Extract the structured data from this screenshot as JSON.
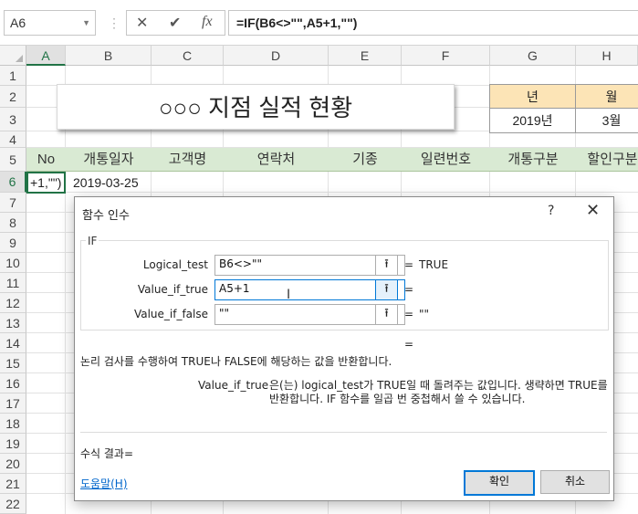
{
  "formula_bar": {
    "name_box": "A6",
    "cancel_glyph": "✕",
    "enter_glyph": "✔",
    "fx_glyph": "fx",
    "formula": "=IF(B6<>\"\",A5+1,\"\")"
  },
  "sheet": {
    "columns": [
      "A",
      "B",
      "C",
      "D",
      "E",
      "F",
      "G",
      "H"
    ],
    "rows": [
      "1",
      "2",
      "3",
      "4",
      "5",
      "6",
      "7",
      "8",
      "9",
      "10",
      "11",
      "12",
      "13",
      "14",
      "15",
      "16",
      "17",
      "18",
      "19",
      "20",
      "21",
      "22"
    ],
    "title": "○○○ 지점  실적 현황",
    "year_header": "년",
    "month_header": "월",
    "year_value": "2019년",
    "month_value": "3월",
    "headers": [
      "No",
      "개통일자",
      "고객명",
      "연락처",
      "기종",
      "일련번호",
      "개통구분",
      "할인구분"
    ],
    "a6_text": "+1,\"\")",
    "b6_text": "2019-03-25"
  },
  "dialog": {
    "title": "함수 인수",
    "help_glyph": "?",
    "close_glyph": "✕",
    "function_name": "IF",
    "args": [
      {
        "label": "Logical_test",
        "value": "B6<>\"\"",
        "result": "TRUE"
      },
      {
        "label": "Value_if_true",
        "value": "A5+1",
        "result": ""
      },
      {
        "label": "Value_if_false",
        "value": "\"\"",
        "result": "\"\""
      }
    ],
    "collapse_glyph": "⭱",
    "equals": "=",
    "description": "논리 검사를 수행하여 TRUE나 FALSE에 해당하는 값을 반환합니다.",
    "arg_name": "Value_if_true",
    "arg_description": "은(는) logical_test가 TRUE일 때 돌려주는 값입니다. 생략하면 TRUE를 반환합니다. IF 함수를 일곱 번 중첩해서 쓸 수 있습니다.",
    "formula_result_label": "수식 결과=",
    "help_link": "도움말(H)",
    "ok": "확인",
    "cancel": "취소"
  },
  "colors": {
    "accent": "#217346",
    "header_band": "#d9ead3",
    "year_header_bg": "#fce4b6",
    "dialog_focus": "#0078d7"
  }
}
